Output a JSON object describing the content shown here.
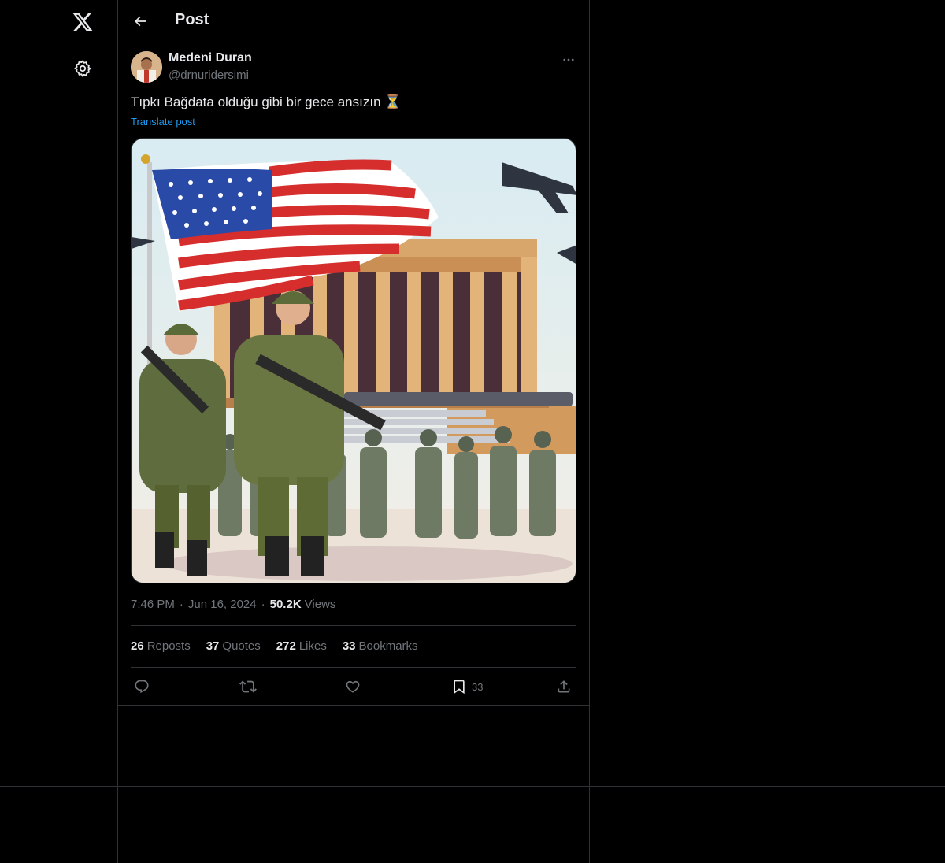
{
  "nav": {
    "logo_icon": "x-logo-icon",
    "settings_icon": "gear-icon"
  },
  "header": {
    "back_icon": "arrow-left-icon",
    "title": "Post"
  },
  "post": {
    "author_name": "Medeni Duran",
    "author_handle": "@drnuridersimi",
    "text": "Tıpkı Bağdata olduğu gibi bir gece ansızın",
    "emoji": "⏳",
    "translate_label": "Translate post",
    "time": "7:46 PM",
    "date": "Jun 16, 2024",
    "views_count": "50.2K",
    "views_label": "Views",
    "separator": "·"
  },
  "stats": [
    {
      "count": "26",
      "label": "Reposts"
    },
    {
      "count": "37",
      "label": "Quotes"
    },
    {
      "count": "272",
      "label": "Likes"
    },
    {
      "count": "33",
      "label": "Bookmarks"
    }
  ],
  "actions": {
    "reply_icon": "reply-icon",
    "repost_icon": "repost-icon",
    "like_icon": "heart-icon",
    "bookmark_icon": "bookmark-icon",
    "bookmark_count": "33",
    "share_icon": "share-icon"
  },
  "colors": {
    "background": "#000000",
    "border": "#2f3336",
    "text_primary": "#e7e9ea",
    "text_secondary": "#71767b",
    "link": "#1d9bf0"
  }
}
